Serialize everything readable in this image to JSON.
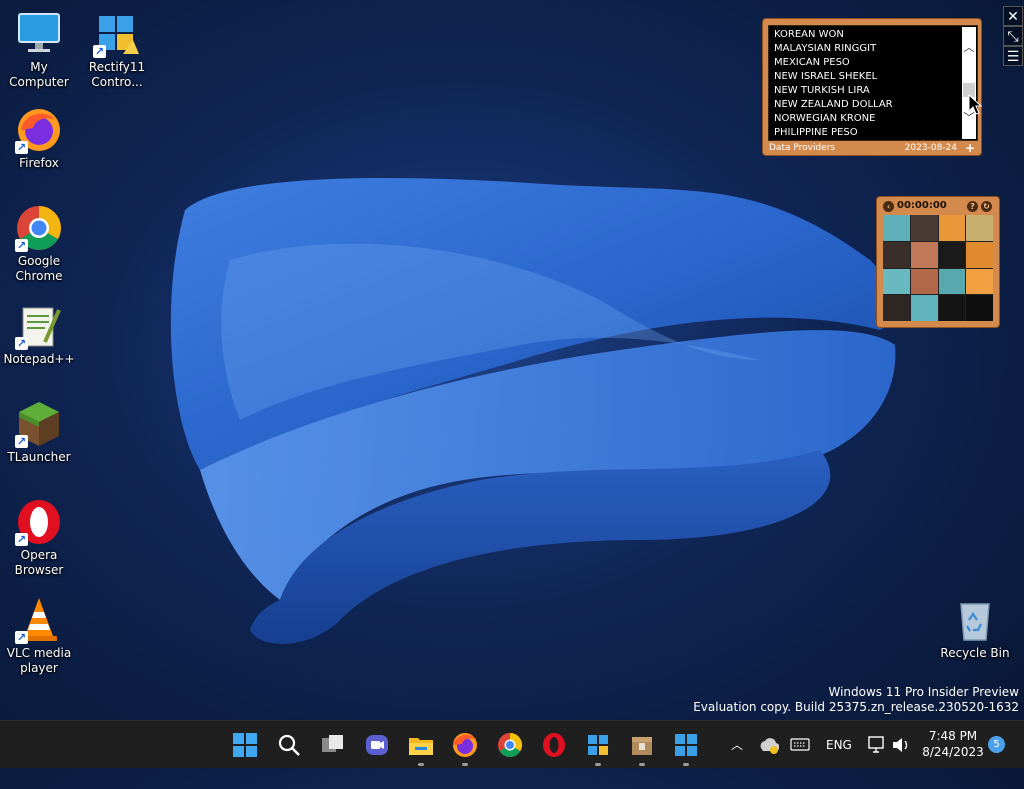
{
  "desktop": {
    "icons": [
      {
        "label": "My Computer"
      },
      {
        "label": "Rectify11 Contro..."
      },
      {
        "label": "Firefox"
      },
      {
        "label": "Google Chrome"
      },
      {
        "label": "Notepad++"
      },
      {
        "label": "TLauncher"
      },
      {
        "label": "Opera Browser"
      },
      {
        "label": "VLC media player"
      },
      {
        "label": "Recycle Bin"
      }
    ]
  },
  "currency_gadget": {
    "items": [
      "KOREAN WON",
      "MALAYSIAN RINGGIT",
      "MEXICAN PESO",
      "NEW ISRAEL SHEKEL",
      "NEW TURKISH LIRA",
      "NEW ZEALAND DOLLAR",
      "NORWEGIAN KRONE",
      "PHILIPPINE PESO"
    ],
    "footer_label": "Data Providers",
    "date": "2023-08-24",
    "add_label": "+"
  },
  "puzzle_gadget": {
    "timer": "00:00:00"
  },
  "watermark": {
    "line1": "Windows 11 Pro Insider Preview",
    "line2": "Evaluation copy. Build 25375.zn_release.230520-1632"
  },
  "taskbar": {
    "tray": {
      "language": "ENG",
      "time": "7:48 PM",
      "date": "8/24/2023",
      "notifications": "5"
    }
  },
  "colors": {
    "taskbar": "#1f1f1f",
    "gadget_frame": "#d48a4c",
    "accent": "#4aa0ea"
  }
}
